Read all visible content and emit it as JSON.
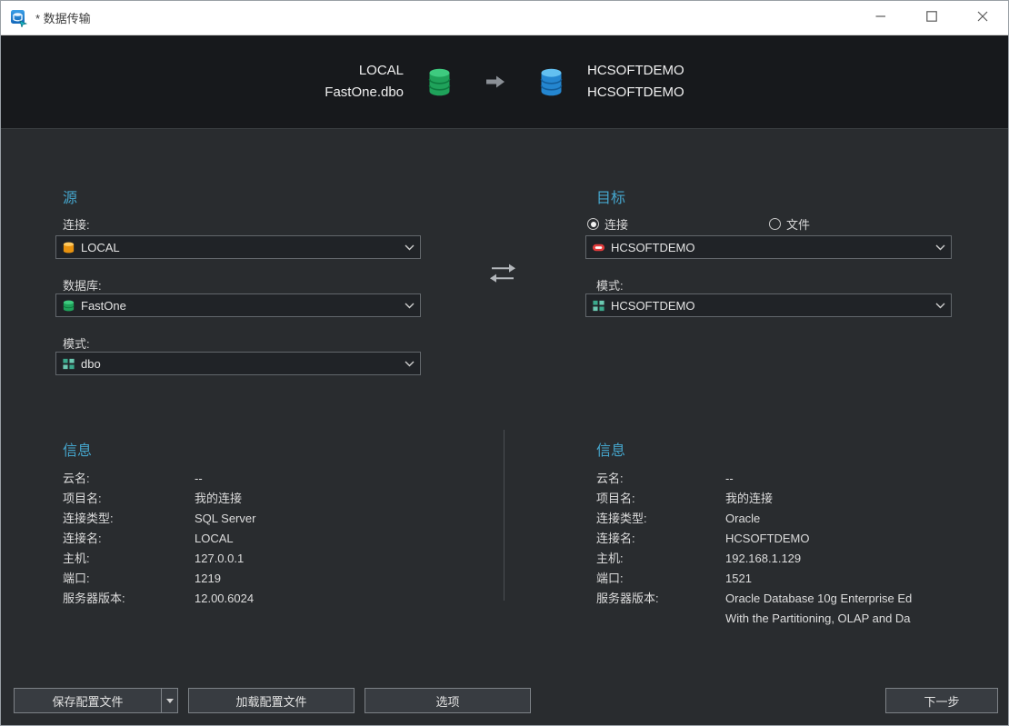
{
  "window": {
    "title": "* 数据传输"
  },
  "header": {
    "source_line1": "LOCAL",
    "source_line2": "FastOne.dbo",
    "target_line1": "HCSOFTDEMO",
    "target_line2": "HCSOFTDEMO"
  },
  "source": {
    "section_title": "源",
    "connection_label": "连接:",
    "connection_value": "LOCAL",
    "database_label": "数据库:",
    "database_value": "FastOne",
    "schema_label": "模式:",
    "schema_value": "dbo"
  },
  "target": {
    "section_title": "目标",
    "radio_connection_label": "连接",
    "radio_file_label": "文件",
    "connection_value": "HCSOFTDEMO",
    "schema_label": "模式:",
    "schema_value": "HCSOFTDEMO"
  },
  "source_info": {
    "section_title": "信息",
    "rows": [
      {
        "label": "云名:",
        "value": "--"
      },
      {
        "label": "项目名:",
        "value": "我的连接"
      },
      {
        "label": "连接类型:",
        "value": "SQL Server"
      },
      {
        "label": "连接名:",
        "value": "LOCAL"
      },
      {
        "label": "主机:",
        "value": "127.0.0.1"
      },
      {
        "label": "端口:",
        "value": "1219"
      },
      {
        "label": "服务器版本:",
        "value": "12.00.6024"
      }
    ]
  },
  "target_info": {
    "section_title": "信息",
    "rows": [
      {
        "label": "云名:",
        "value": "--"
      },
      {
        "label": "项目名:",
        "value": "我的连接"
      },
      {
        "label": "连接类型:",
        "value": "Oracle"
      },
      {
        "label": "连接名:",
        "value": "HCSOFTDEMO"
      },
      {
        "label": "主机:",
        "value": "192.168.1.129"
      },
      {
        "label": "端口:",
        "value": "1521"
      },
      {
        "label": "服务器版本:",
        "value": "Oracle Database 10g Enterprise Ed",
        "value2": "With the Partitioning, OLAP and Da"
      }
    ]
  },
  "footer": {
    "save_profile_label": "保存配置文件",
    "load_profile_label": "加载配置文件",
    "options_label": "选项",
    "next_label": "下一步"
  },
  "icons": {
    "app_icon": "database-transfer",
    "header_source": "green-database-cylinder",
    "header_target": "blue-database-cylinder",
    "header_arrow": "right-arrow",
    "source_connection": "orange-database",
    "source_database": "green-database",
    "schema": "teal-schema-grid",
    "target_connection": "oracle-red",
    "swap": "swap-arrows"
  },
  "colors": {
    "accent": "#45a6cd",
    "titlebar_bg": "#ffffff",
    "header_bg": "#17191c",
    "body_bg": "#292c2f",
    "combo_bg": "#202327",
    "button_bg": "#383c41"
  }
}
